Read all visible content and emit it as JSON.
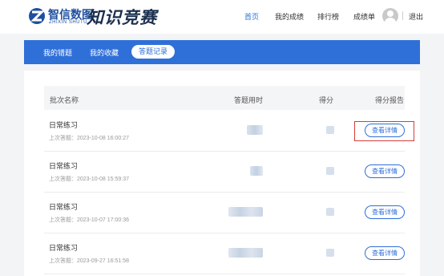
{
  "header": {
    "logo_cn": "智信数图",
    "logo_en": "ZHIXIN SHUTU",
    "brand_title": "知识竞赛",
    "nav": [
      "首页",
      "我的成绩",
      "排行榜",
      "成绩单"
    ],
    "logout": "退出"
  },
  "tabs": [
    "我的错题",
    "我的收藏",
    "答题记录"
  ],
  "table": {
    "headers": [
      "批次名称",
      "答题用时",
      "得分",
      "得分报告"
    ],
    "rows": [
      {
        "name": "日常练习",
        "time": "上次答题：2023-10-08 16:00:27",
        "button": "查看详情"
      },
      {
        "name": "日常练习",
        "time": "上次答题：2023-10-08 15:59:37",
        "button": "查看详情"
      },
      {
        "name": "日常练习",
        "time": "上次答题：2023-10-07 17:00:36",
        "button": "查看详情"
      },
      {
        "name": "日常练习",
        "time": "上次答题：2023-09-27 16:51:58",
        "button": "查看详情"
      }
    ]
  },
  "colors": {
    "primary": "#2f6fd8",
    "highlight": "#d63c3c"
  }
}
